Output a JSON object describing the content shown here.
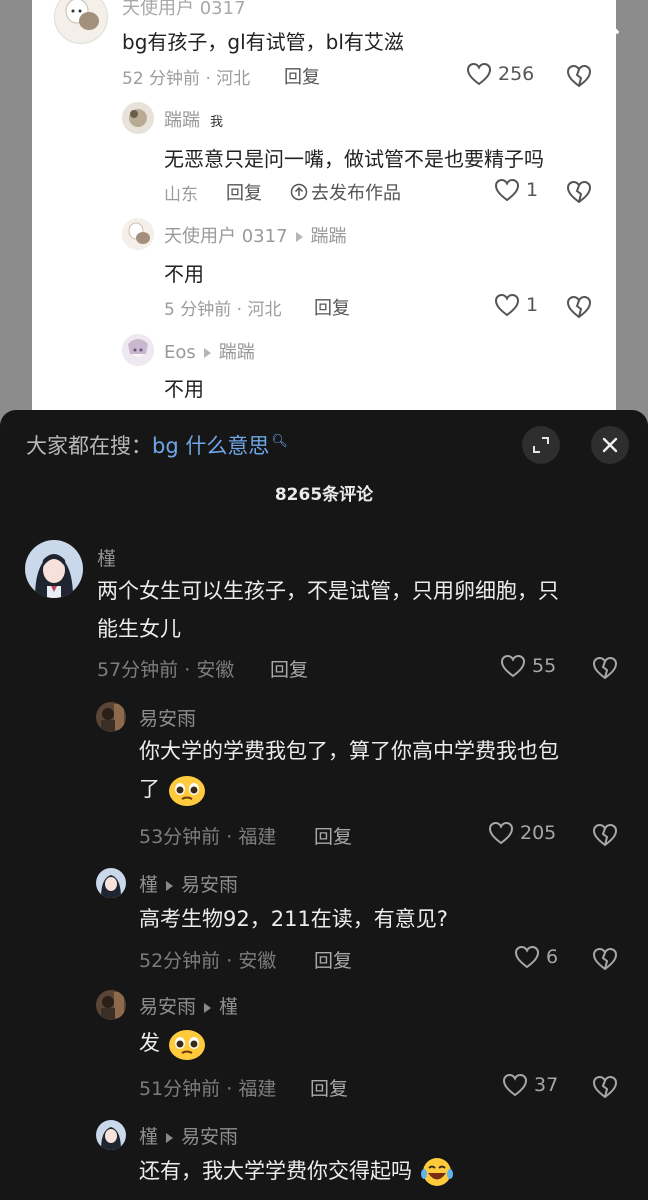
{
  "top": {
    "comment_main": {
      "username": "天使用户 0317",
      "text": "bg有孩子，gl有试管，bl有艾滋",
      "time": "52 分钟前",
      "location": "河北",
      "reply": "回复",
      "likes": "256"
    },
    "replies": [
      {
        "username": "踹踹",
        "author_tag": "我",
        "text": "无恶意只是问一嘴，做试管不是也要精子吗",
        "location": "山东",
        "reply": "回复",
        "share": "去发布作品",
        "likes": "1"
      },
      {
        "username": "天使用户 0317",
        "reply_to": "踹踹",
        "text": "不用",
        "time": "5 分钟前",
        "location": "河北",
        "reply": "回复",
        "likes": "1"
      },
      {
        "username": "Eos",
        "reply_to": "踹踹",
        "text": "不用"
      }
    ]
  },
  "sheet": {
    "hot_search_prefix": "大家都在搜：",
    "hot_search_term": "bg 什么意思",
    "comment_count": "8265条评论",
    "comments": [
      {
        "username": "槿",
        "text_line1": "两个女生可以生孩子，不是试管，只用卵细胞，只",
        "text_line2": "能生女儿",
        "time": "57分钟前",
        "location": "安徽",
        "reply": "回复",
        "likes": "55"
      },
      {
        "username": "易安雨",
        "text_line1": "你大学的学费我包了，算了你高中学费我也包",
        "text_line2": "了",
        "time": "53分钟前",
        "location": "福建",
        "reply": "回复",
        "likes": "205"
      },
      {
        "username": "槿",
        "reply_to": "易安雨",
        "text_line1": "高考生物92，211在读，有意见?",
        "time": "52分钟前",
        "location": "安徽",
        "reply": "回复",
        "likes": "6"
      },
      {
        "username": "易安雨",
        "reply_to": "槿",
        "text_line1": "发",
        "time": "51分钟前",
        "location": "福建",
        "reply": "回复",
        "likes": "37"
      },
      {
        "username": "槿",
        "reply_to": "易安雨",
        "text_line1": "还有，我大学学费你交得起吗"
      }
    ],
    "meta_separator": "·"
  },
  "colors": {
    "link_blue": "#6fa6e8",
    "sheet_bg": "#161616",
    "top_bg": "#ffffff"
  },
  "icons": [
    "search-icon",
    "heart-icon",
    "broken-heart-icon",
    "expand-icon",
    "close-icon",
    "share-icon"
  ]
}
